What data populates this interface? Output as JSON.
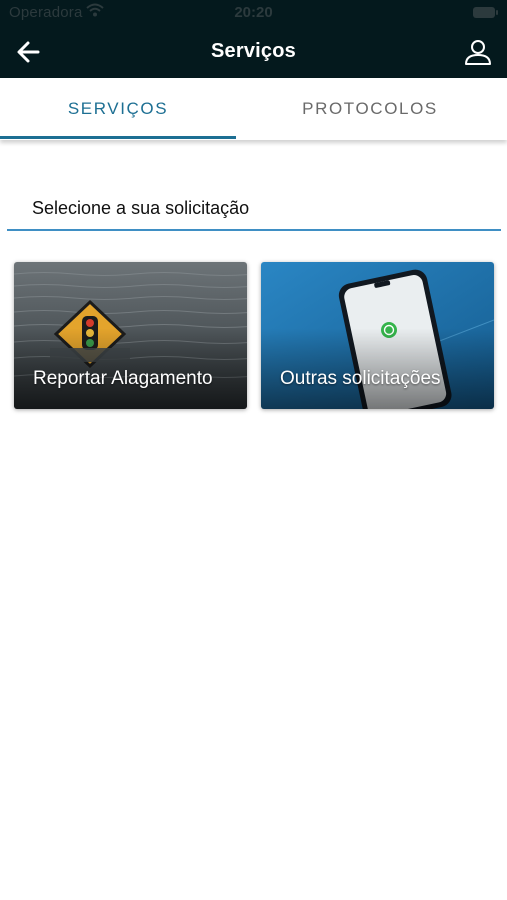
{
  "status_bar": {
    "carrier": "Operadora",
    "time": "20:20"
  },
  "header": {
    "title": "Serviços"
  },
  "tabs": [
    {
      "label": "SERVIÇOS",
      "active": true
    },
    {
      "label": "PROTOCOLOS",
      "active": false
    }
  ],
  "select_field": {
    "label": "Selecione a sua solicitação"
  },
  "cards": [
    {
      "label": "Reportar Alagamento"
    },
    {
      "label": "Outras solicitações"
    }
  ],
  "colors": {
    "nav_background": "#04191d",
    "accent": "#1d6f93",
    "field_underline": "#3f8fc4"
  }
}
